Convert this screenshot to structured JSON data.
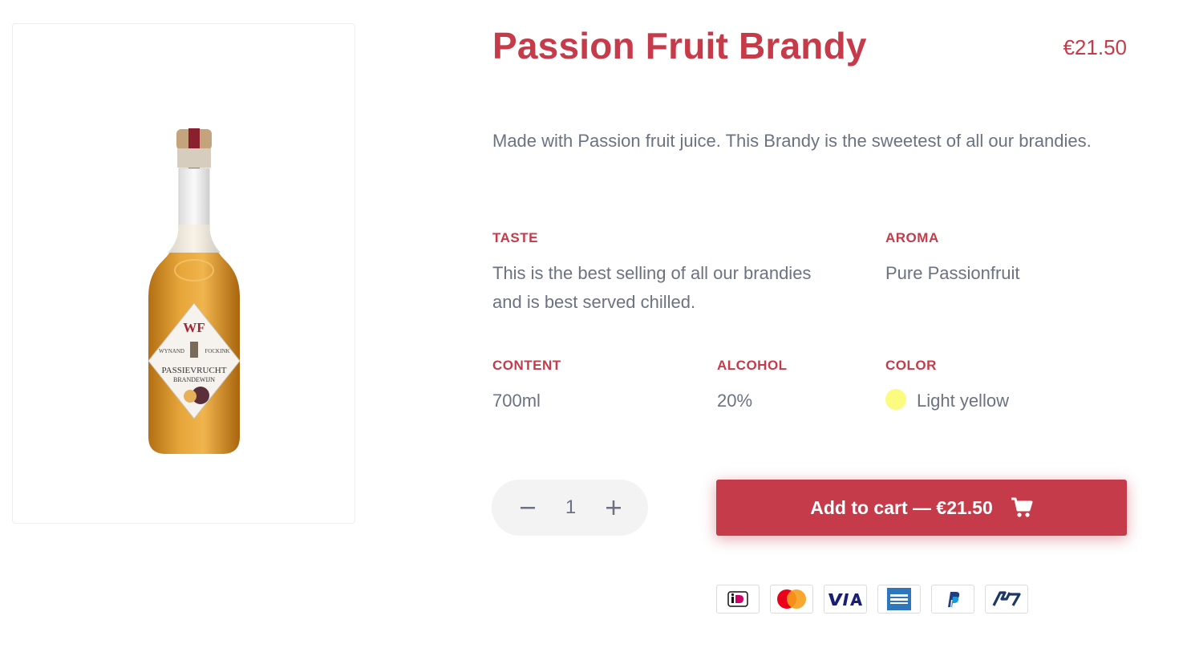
{
  "product": {
    "title": "Passion Fruit Brandy",
    "price": "€21.50",
    "description": "Made with Passion fruit juice. This Brandy is the sweetest of all our brandies.",
    "image_label": {
      "brand_mark": "WF",
      "brand_name_left": "WYNAND",
      "brand_name_right": "FOCKINK",
      "product_name": "PASSIEVRUCHT",
      "product_type": "BRANDEWIJN"
    }
  },
  "attributes": {
    "taste": {
      "label": "TASTE",
      "value_line1": "This is the best selling of all our brandies",
      "value_line2": "and is best served chilled."
    },
    "aroma": {
      "label": "AROMA",
      "value": "Pure Passionfruit"
    },
    "content": {
      "label": "CONTENT",
      "value": "700ml"
    },
    "alcohol": {
      "label": "ALCOHOL",
      "value": "20%"
    },
    "color": {
      "label": "COLOR",
      "value": "Light yellow",
      "swatch": "#fbfb7f"
    }
  },
  "quantity": {
    "value": "1"
  },
  "cart": {
    "label": "Add to cart — €21.50",
    "icon": "cart-icon"
  },
  "payment_methods": [
    "ideal",
    "mastercard",
    "visa",
    "american-express",
    "paypal",
    "bancontact"
  ],
  "colors": {
    "accent": "#c53b4a",
    "text": "#6b7280"
  }
}
